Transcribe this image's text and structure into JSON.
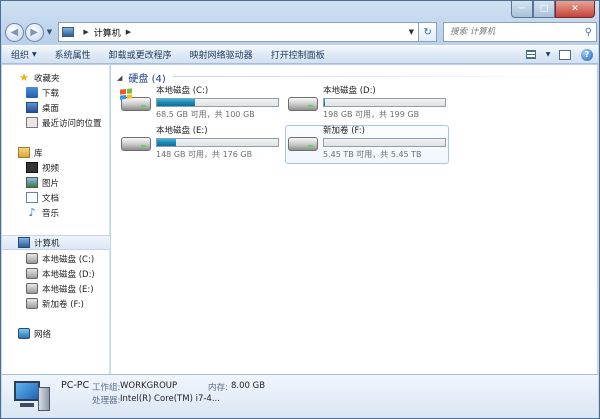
{
  "window": {
    "title": "计算机",
    "minimize": "─",
    "maximize": "□",
    "close": "✕"
  },
  "address": {
    "back_icon": "back-arrow-icon",
    "forward_icon": "forward-arrow-icon",
    "location": "计算机",
    "search_placeholder": "搜索 计算机"
  },
  "toolbar": {
    "items": [
      "组织",
      "系统属性",
      "卸载或更改程序",
      "映射网络驱动器",
      "打开控制面板"
    ],
    "help": "?"
  },
  "sidebar": {
    "favorites": {
      "label": "收藏夹",
      "items": [
        "下载",
        "桌面",
        "最近访问的位置"
      ]
    },
    "libraries": {
      "label": "库",
      "items": [
        "视频",
        "图片",
        "文档",
        "音乐"
      ]
    },
    "computer": {
      "label": "计算机",
      "items": [
        "本地磁盘 (C:)",
        "本地磁盘 (D:)",
        "本地磁盘 (E:)",
        "新加卷 (F:)"
      ]
    },
    "network": {
      "label": "网络"
    }
  },
  "main": {
    "group_title": "硬盘 (4)",
    "drives": [
      {
        "name": "本地磁盘 (C:)",
        "space": "68.5 GB 可用，共 100 GB",
        "used_fraction": 0.315,
        "system": true
      },
      {
        "name": "本地磁盘 (D:)",
        "space": "198 GB 可用，共 199 GB",
        "used_fraction": 0.005,
        "system": false
      },
      {
        "name": "本地磁盘 (E:)",
        "space": "148 GB 可用，共 176 GB",
        "used_fraction": 0.159,
        "system": false
      },
      {
        "name": "新加卷 (F:)",
        "space": "5.45 TB 可用，共 5.45 TB",
        "used_fraction": 0.0,
        "system": false
      }
    ]
  },
  "details": {
    "computer_name": "PC-PC",
    "workgroup_label": "工作组:",
    "workgroup_value": "WORKGROUP",
    "memory_label": "内存:",
    "memory_value": "8.00 GB",
    "processor_label": "处理器:",
    "processor_value": "Intel(R) Core(TM) i7-4..."
  },
  "colors": {
    "bar_fill": "#1a88b5",
    "link": "#1e3c8a"
  }
}
